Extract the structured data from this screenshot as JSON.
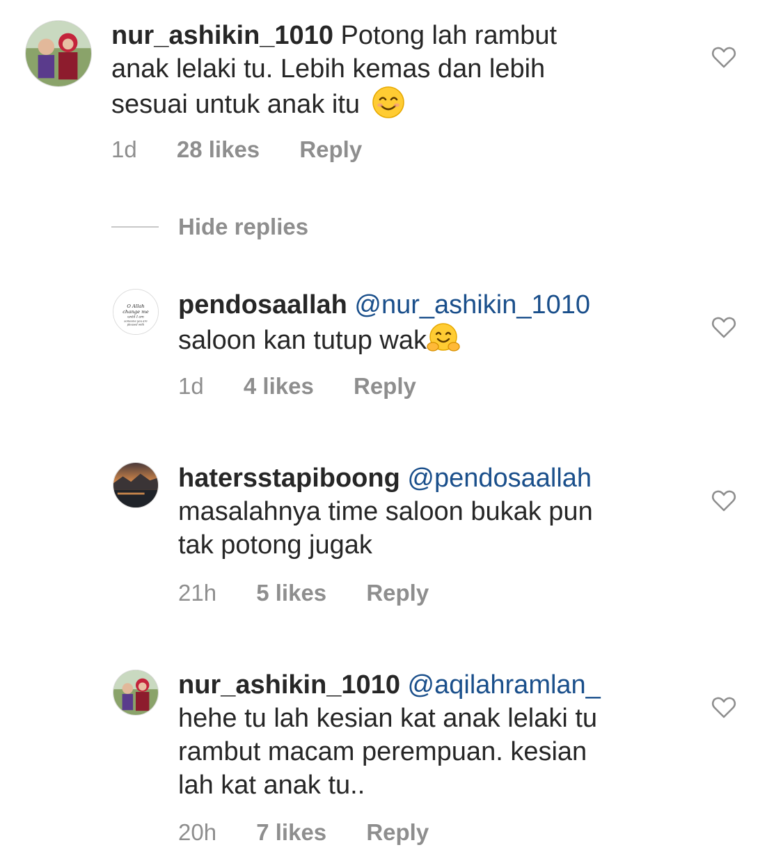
{
  "comments": [
    {
      "username": "nur_ashikin_1010",
      "mention": "",
      "lines": [
        "Potong lah rambut",
        "anak lelaki tu. Lebih kemas dan lebih",
        "sesuai untuk anak itu"
      ],
      "emoji": "smiling-face-icon",
      "time": "1d",
      "likes": "28 likes",
      "reply": "Reply"
    },
    {
      "username": "pendosaallah",
      "mention": "@nur_ashikin_1010",
      "lines": [
        "saloon kan tutup wak"
      ],
      "emoji": "hugging-face-icon",
      "time": "1d",
      "likes": "4 likes",
      "reply": "Reply"
    },
    {
      "username": "hatersstapiboong",
      "mention": "@pendosaallah",
      "lines": [
        "masalahnya time saloon bukak pun",
        "tak potong jugak"
      ],
      "time": "21h",
      "likes": "5 likes",
      "reply": "Reply"
    },
    {
      "username": "nur_ashikin_1010",
      "mention": "@aqilahramlan_",
      "lines": [
        "hehe tu lah kesian kat anak lelaki tu",
        "rambut macam perempuan. kesian",
        "lah kat anak tu.."
      ],
      "time": "20h",
      "likes": "7 likes",
      "reply": "Reply"
    }
  ],
  "hide_replies": "Hide replies",
  "colors": {
    "text": "#262626",
    "meta": "#8e8e8e",
    "mention": "#1a4f8b",
    "divider": "#c7c7c7"
  }
}
